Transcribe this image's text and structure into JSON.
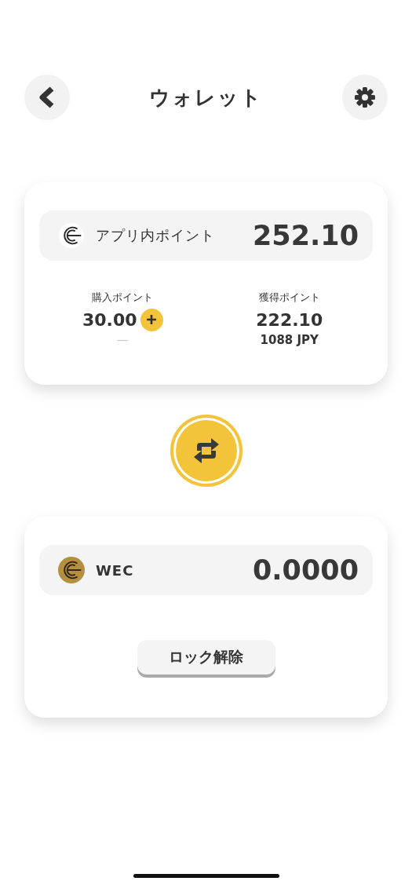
{
  "header": {
    "title": "ウォレット"
  },
  "points_card": {
    "label": "アプリ内ポイント",
    "total": "252.10",
    "stats": [
      {
        "label": "購入ポイント",
        "value": "30.00",
        "sub": "—",
        "kind": "purchase"
      },
      {
        "label": "獲得ポイント",
        "value": "222.10",
        "sub": "1088 JPY",
        "kind": "earned"
      }
    ]
  },
  "wec_card": {
    "label": "WEC",
    "total": "0.0000",
    "button": "ロック解除"
  }
}
